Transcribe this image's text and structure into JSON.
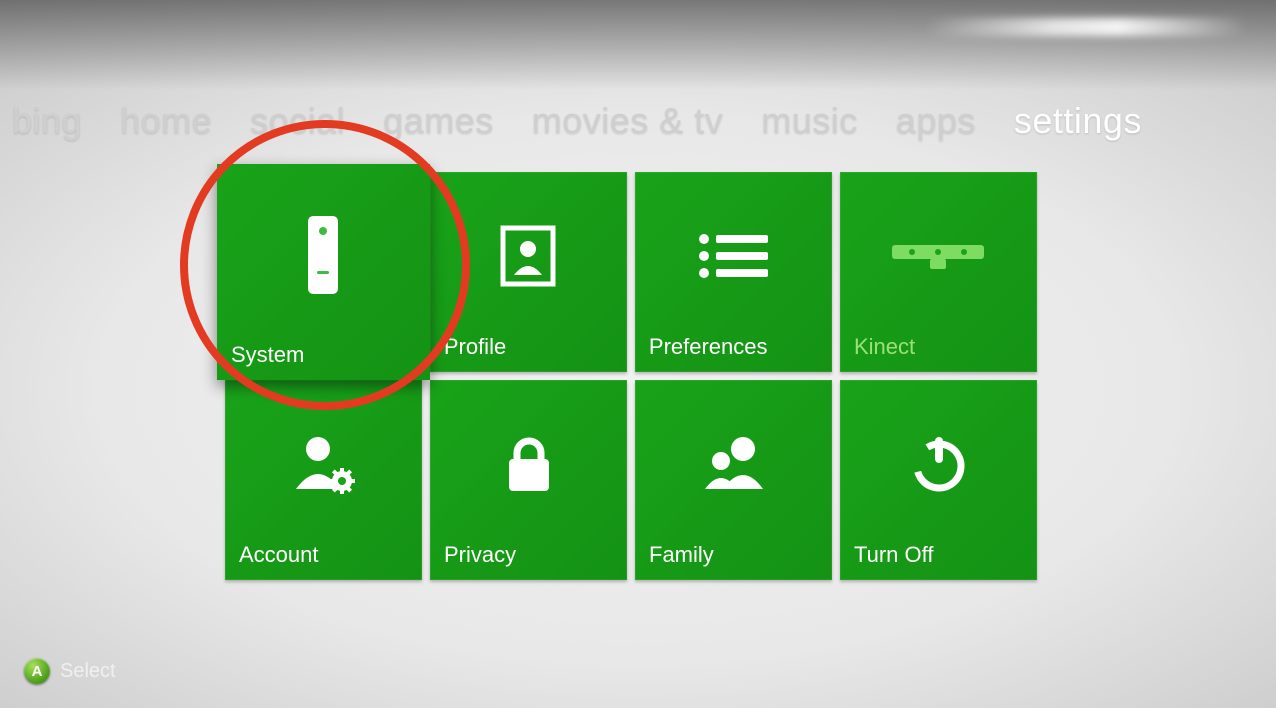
{
  "nav": {
    "items": [
      {
        "label": "bing"
      },
      {
        "label": "home"
      },
      {
        "label": "social"
      },
      {
        "label": "games"
      },
      {
        "label": "movies & tv"
      },
      {
        "label": "music"
      },
      {
        "label": "apps"
      },
      {
        "label": "settings"
      }
    ],
    "active_index": 7
  },
  "tiles": [
    {
      "label": "System",
      "icon": "console-icon",
      "selected": true
    },
    {
      "label": "Profile",
      "icon": "profile-icon"
    },
    {
      "label": "Preferences",
      "icon": "list-icon"
    },
    {
      "label": "Kinect",
      "icon": "kinect-icon",
      "dim": true
    },
    {
      "label": "Account",
      "icon": "account-gear-icon"
    },
    {
      "label": "Privacy",
      "icon": "lock-icon"
    },
    {
      "label": "Family",
      "icon": "family-icon"
    },
    {
      "label": "Turn Off",
      "icon": "power-icon"
    }
  ],
  "hint": {
    "button_letter": "A",
    "label": "Select"
  },
  "colors": {
    "tile_green": "#19a319",
    "annotation_red": "#e23b21"
  },
  "annotation": {
    "target_tile_index": 0,
    "shape": "circle"
  }
}
